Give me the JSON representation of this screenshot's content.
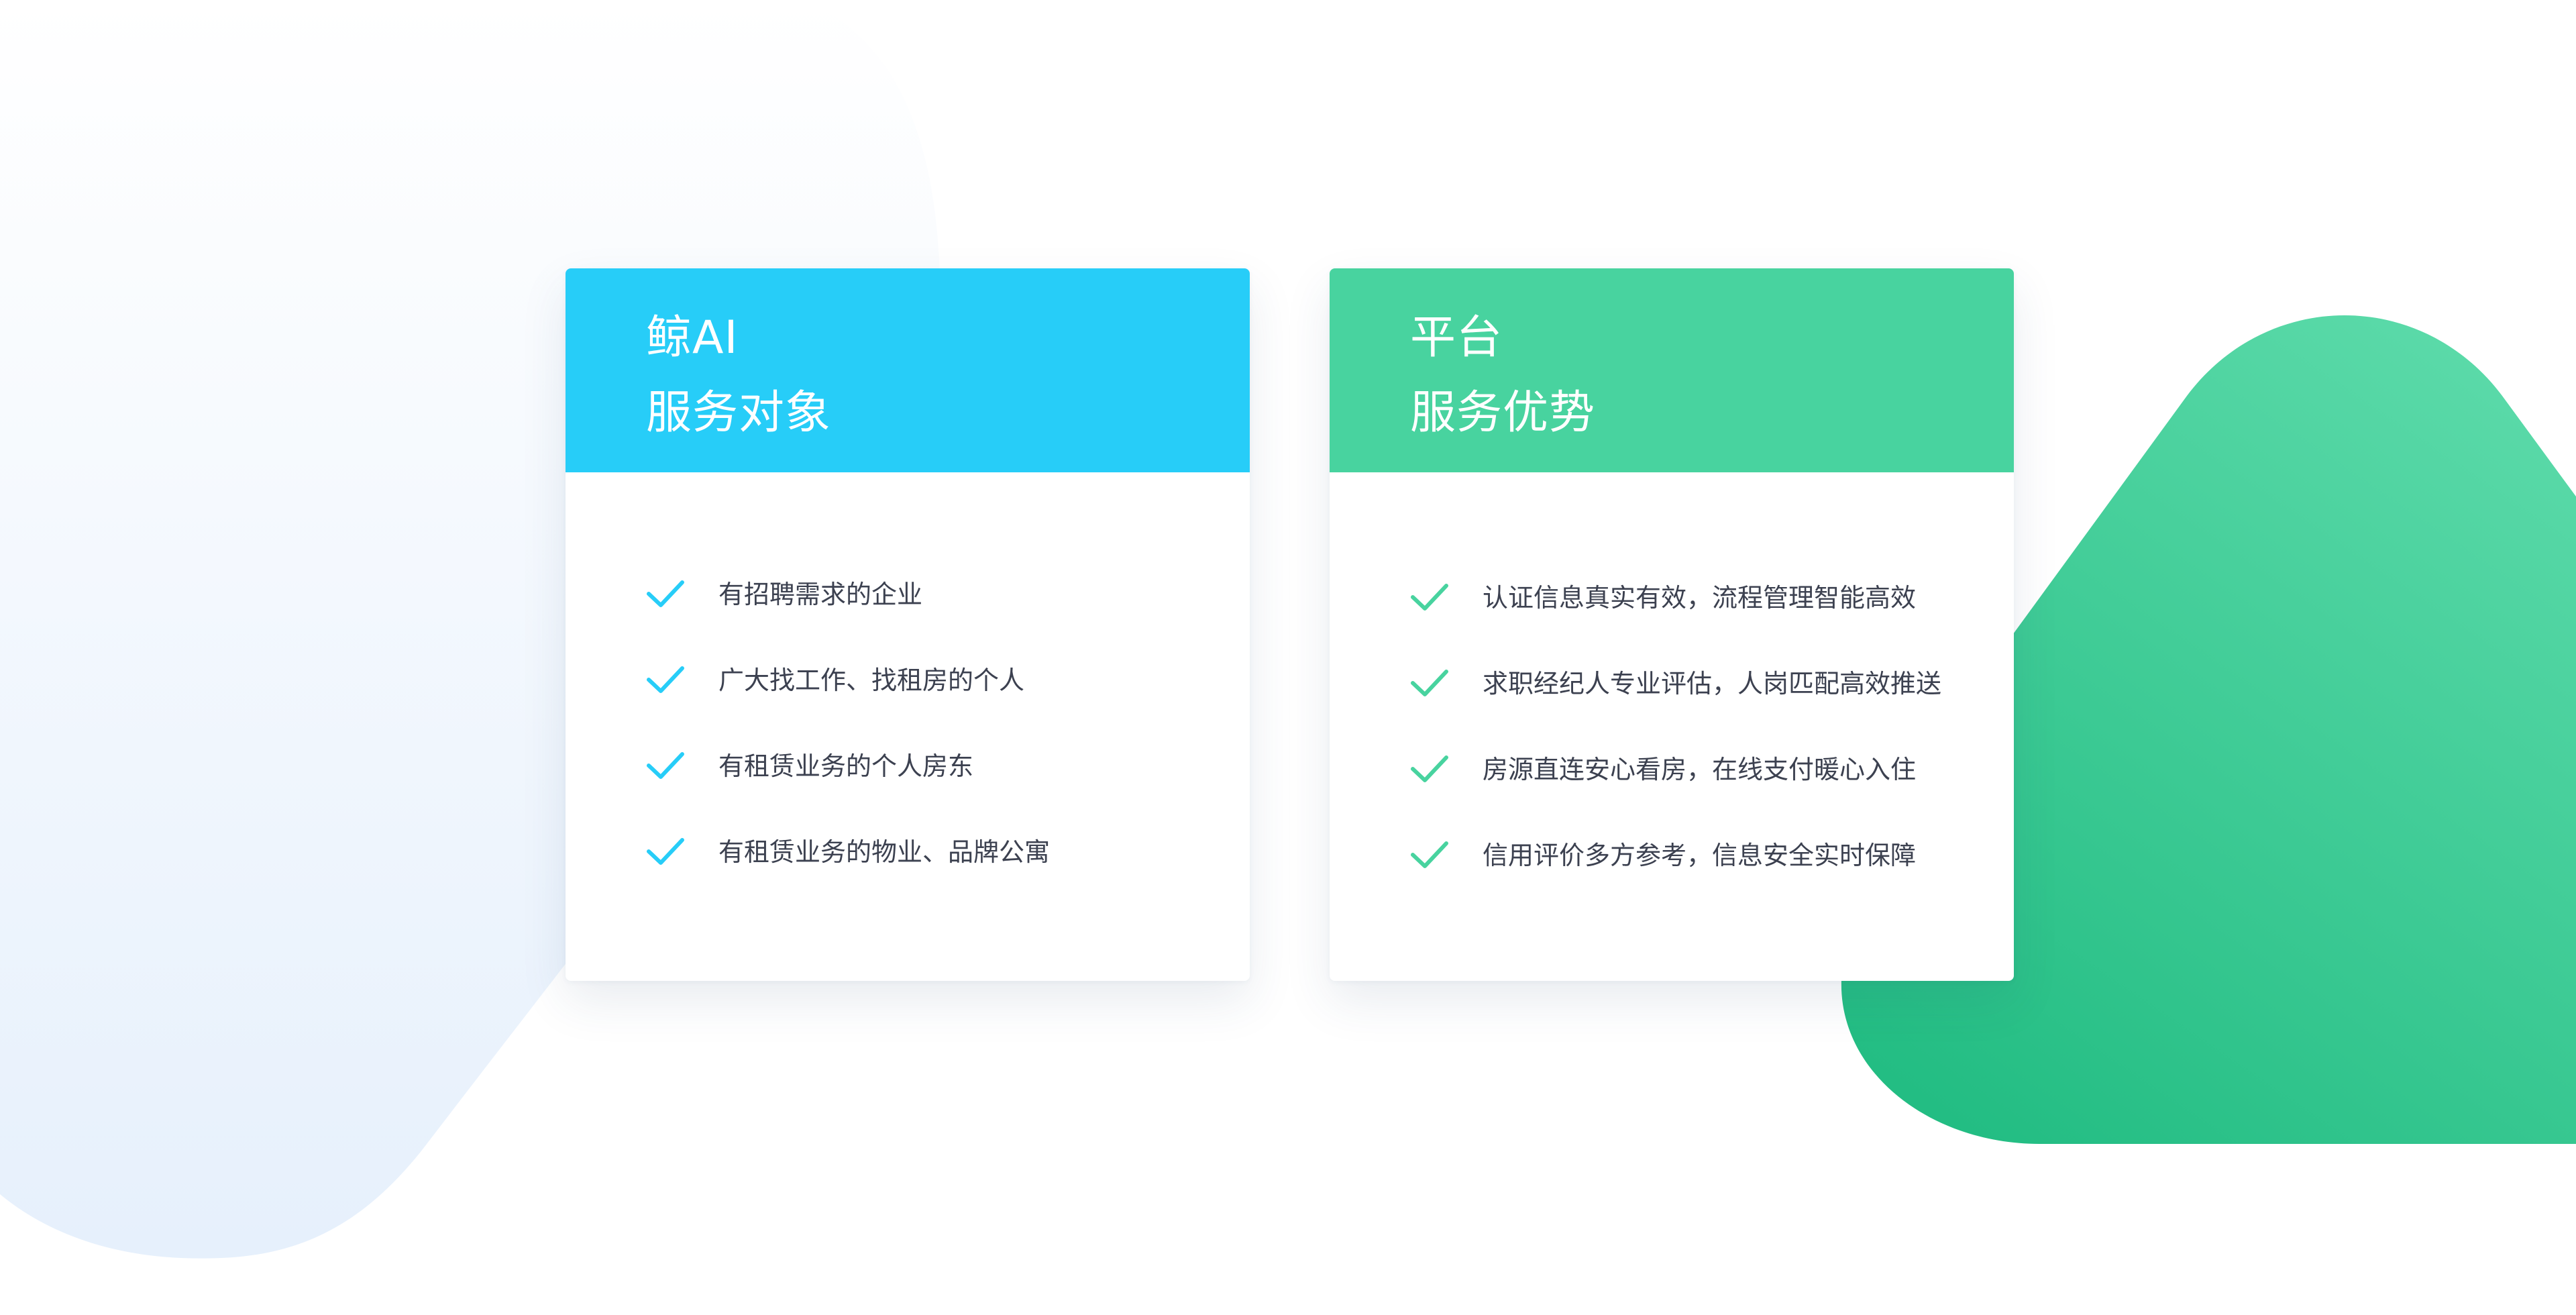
{
  "colors": {
    "blue_accent": "#27cdf8",
    "green_accent": "#48d39f",
    "text": "#3c4150",
    "bg_blob": "#eaf3fd",
    "bg_green": "#2fc38a"
  },
  "cards": [
    {
      "title_line1": "鲸AI",
      "title_line2": "服务对象",
      "icon": "check-icon",
      "items": [
        "有招聘需求的企业",
        "广大找工作、找租房的个人",
        "有租赁业务的个人房东",
        "有租赁业务的物业、品牌公寓"
      ]
    },
    {
      "title_line1": "平台",
      "title_line2": "服务优势",
      "icon": "check-icon",
      "items": [
        "认证信息真实有效，流程管理智能高效",
        "求职经纪人专业评估，人岗匹配高效推送",
        "房源直连安心看房，在线支付暖心入住",
        "信用评价多方参考，信息安全实时保障"
      ]
    }
  ]
}
